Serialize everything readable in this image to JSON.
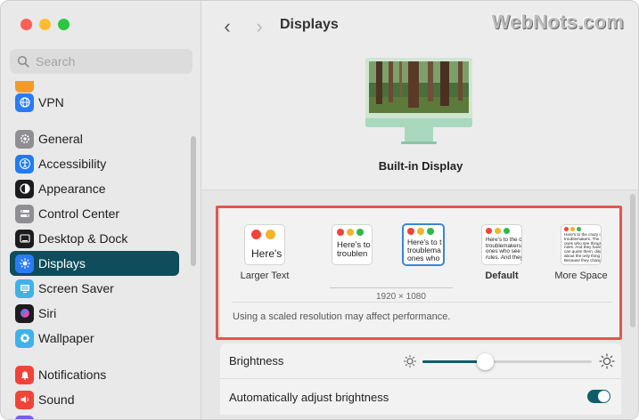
{
  "window": {
    "traffic_lights": [
      "close",
      "minimize",
      "zoom"
    ]
  },
  "search": {
    "placeholder": "Search"
  },
  "sidebar": {
    "items": [
      {
        "label": "VPN",
        "icon": "globe-icon",
        "color": "#2a7bf6"
      },
      {
        "label": "General",
        "icon": "gear-icon",
        "color": "#8e8e93"
      },
      {
        "label": "Accessibility",
        "icon": "accessibility-icon",
        "color": "#1f7cf5"
      },
      {
        "label": "Appearance",
        "icon": "appearance-icon",
        "color": "#1c1c1e"
      },
      {
        "label": "Control Center",
        "icon": "control-center-icon",
        "color": "#8e8e93"
      },
      {
        "label": "Desktop & Dock",
        "icon": "dock-icon",
        "color": "#1c1c1e"
      },
      {
        "label": "Displays",
        "icon": "sun-icon",
        "color": "#2a7bf6",
        "active": true
      },
      {
        "label": "Screen Saver",
        "icon": "screen-saver-icon",
        "color": "#3fb3e8"
      },
      {
        "label": "Siri",
        "icon": "siri-icon",
        "color": "#1c1c1e"
      },
      {
        "label": "Wallpaper",
        "icon": "wallpaper-icon",
        "color": "#3fb3e8"
      },
      {
        "label": "Notifications",
        "icon": "bell-icon",
        "color": "#f0443a"
      },
      {
        "label": "Sound",
        "icon": "speaker-icon",
        "color": "#f0443a"
      }
    ]
  },
  "toolbar": {
    "back": "‹",
    "forward": "›",
    "title": "Displays",
    "watermark": "WebNots.com"
  },
  "display": {
    "name": "Built-in Display"
  },
  "resolution": {
    "options": [
      {
        "label": "Larger Text",
        "sample": "Here's"
      },
      {
        "label": "",
        "sample": "Here's to\ntroublen"
      },
      {
        "label": "",
        "sample": "Here's to t\ntroublema\nones who",
        "selected": true
      },
      {
        "label": "Default",
        "sample": "Here's to the c\ntroublemakers.\nones who see th\nrules. And they"
      },
      {
        "label": "More Space",
        "sample": "Here's to the crazy one\ntroublemakers. The rou\nones who see things di\nrules. And they have n\ncan quote them, disagre\nabout the only thing yo\nBecause they change th"
      }
    ],
    "current": "1920 × 1080",
    "note": "Using a scaled resolution may affect performance."
  },
  "brightness": {
    "label": "Brightness",
    "level": 0.37
  },
  "auto_brightness": {
    "label": "Automatically adjust brightness",
    "enabled": true
  },
  "colors": {
    "accent": "#0f4c5c",
    "highlight": "#e2574c",
    "selection": "#3a86d5"
  }
}
